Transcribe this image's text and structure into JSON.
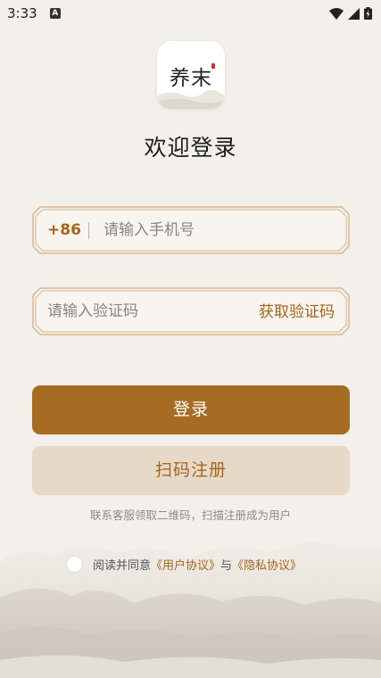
{
  "status_bar": {
    "time": "3:33",
    "notification": "A"
  },
  "logo": {
    "text": "养末"
  },
  "title": "欢迎登录",
  "phone_field": {
    "country_code": "+86",
    "placeholder": "请输入手机号"
  },
  "code_field": {
    "placeholder": "请输入验证码",
    "get_code_label": "获取验证码"
  },
  "buttons": {
    "login": "登录",
    "register": "扫码注册"
  },
  "hint": "联系客服领取二维码，扫描注册成为用户",
  "agreement": {
    "prefix": "阅读并同意",
    "user_agreement": "《用户协议》",
    "conjunction": "与",
    "privacy_agreement": "《隐私协议》"
  },
  "colors": {
    "background": "#f3efea",
    "accent": "#a66c23",
    "accent_text": "#a3661e",
    "secondary_button": "#e6d9c8"
  },
  "icons": [
    "wifi-icon",
    "signal-icon",
    "battery-icon"
  ]
}
